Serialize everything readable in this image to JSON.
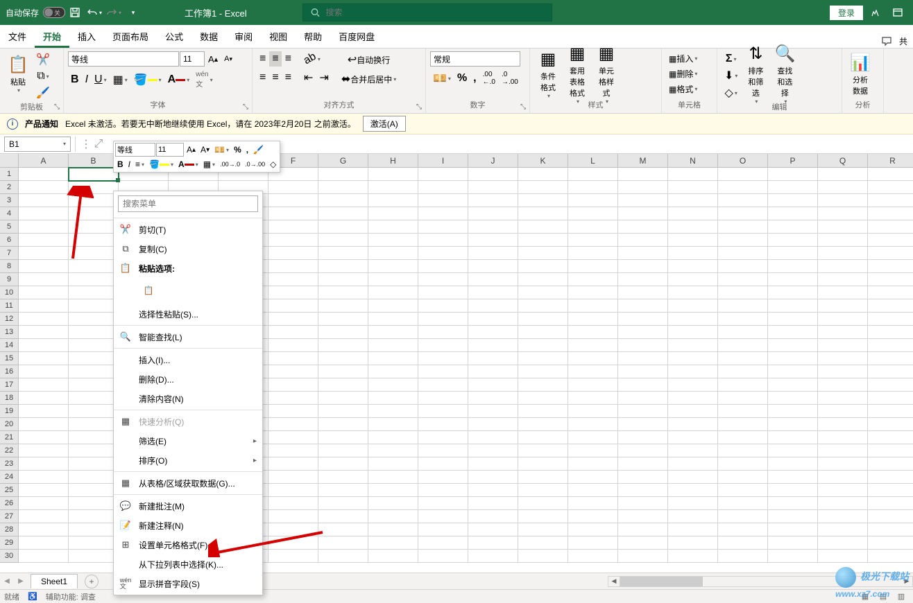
{
  "titlebar": {
    "autosave_label": "自动保存",
    "autosave_state": "关",
    "doc_title": "工作簿1 - Excel",
    "search_placeholder": "搜索",
    "login": "登录"
  },
  "tabs": {
    "file": "文件",
    "home": "开始",
    "insert": "插入",
    "layout": "页面布局",
    "formulas": "公式",
    "data": "数据",
    "review": "审阅",
    "view": "视图",
    "help": "帮助",
    "baidu": "百度网盘",
    "share_hint": "共"
  },
  "ribbon": {
    "clipboard": {
      "paste": "粘贴",
      "label": "剪贴板"
    },
    "font": {
      "family": "等线",
      "size": "11",
      "label": "字体"
    },
    "align": {
      "wrap": "自动换行",
      "merge": "合并后居中",
      "label": "对齐方式"
    },
    "number": {
      "format": "常规",
      "label": "数字"
    },
    "styles": {
      "cond": "条件格式",
      "tablefmt": "套用\n表格格式",
      "cellstyle": "单元格样式",
      "label": "样式"
    },
    "cells": {
      "insert": "插入",
      "delete": "删除",
      "format": "格式",
      "label": "单元格"
    },
    "editing": {
      "sortfilter": "排序和筛选",
      "findselect": "查找和选择",
      "label": "编辑"
    },
    "analysis": {
      "analyze": "分析\n数据",
      "label": "分析"
    }
  },
  "notification": {
    "title": "产品通知",
    "body": "Excel 未激活。若要无中断地继续使用 Excel，请在 2023年2月20日 之前激活。",
    "button": "激活(A)"
  },
  "namebox": {
    "value": "B1"
  },
  "mini_toolbar": {
    "font": "等线",
    "size": "11"
  },
  "columns": [
    "A",
    "B",
    "C",
    "D",
    "E",
    "F",
    "G",
    "H",
    "I",
    "J",
    "K",
    "L",
    "M",
    "N",
    "O",
    "P",
    "Q",
    "R"
  ],
  "row_count": 30,
  "selected_cell": {
    "col": "B",
    "row": 1
  },
  "context_menu": {
    "search_placeholder": "搜索菜单",
    "cut": "剪切(T)",
    "copy": "复制(C)",
    "paste_title": "粘贴选项:",
    "paste_special": "选择性粘贴(S)...",
    "smart_lookup": "智能查找(L)",
    "insert": "插入(I)...",
    "delete": "删除(D)...",
    "clear": "清除内容(N)",
    "quick_analysis": "快速分析(Q)",
    "filter": "筛选(E)",
    "sort": "排序(O)",
    "from_table": "从表格/区域获取数据(G)...",
    "new_comment": "新建批注(M)",
    "new_note": "新建注释(N)",
    "format_cells": "设置单元格格式(F)...",
    "pick_dropdown": "从下拉列表中选择(K)...",
    "show_pinyin": "显示拼音字段(S)"
  },
  "sheet": {
    "name": "Sheet1"
  },
  "status": {
    "ready": "就绪",
    "acc": "辅助功能: 调查"
  },
  "watermark": {
    "brand": "极光下载站",
    "url": "www.xz7.com"
  }
}
